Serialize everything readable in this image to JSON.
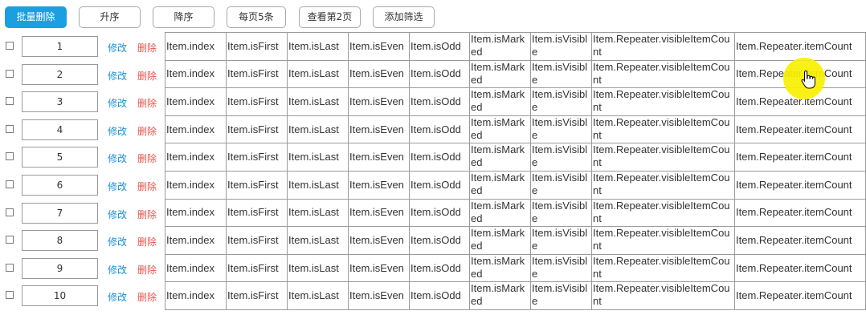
{
  "toolbar": {
    "batch_delete": "批量删除",
    "asc": "升序",
    "desc": "降序",
    "per_page": "每页5条",
    "view_page2": "查看第2页",
    "add_filter": "添加筛选"
  },
  "columns": [
    "Item.index",
    "Item.isFirst",
    "Item.isLast",
    "Item.isEven",
    "Item.isOdd",
    "Item.isMarked",
    "Item.isVisible",
    "Item.Repeater.visibleItemCount",
    "Item.Repeater.itemCount"
  ],
  "rows": [
    {
      "num": "1",
      "edit": "修改",
      "del": "删除"
    },
    {
      "num": "2",
      "edit": "修改",
      "del": "删除"
    },
    {
      "num": "3",
      "edit": "修改",
      "del": "删除"
    },
    {
      "num": "4",
      "edit": "修改",
      "del": "删除"
    },
    {
      "num": "5",
      "edit": "修改",
      "del": "删除"
    },
    {
      "num": "6",
      "edit": "修改",
      "del": "删除"
    },
    {
      "num": "7",
      "edit": "修改",
      "del": "删除"
    },
    {
      "num": "8",
      "edit": "修改",
      "del": "删除"
    },
    {
      "num": "9",
      "edit": "修改",
      "del": "删除"
    },
    {
      "num": "10",
      "edit": "修改",
      "del": "删除"
    }
  ],
  "colors": {
    "primary": "#1a9fe0",
    "link": "#1a8fd6",
    "danger": "#e4574d",
    "highlight": "#f7ec00"
  }
}
